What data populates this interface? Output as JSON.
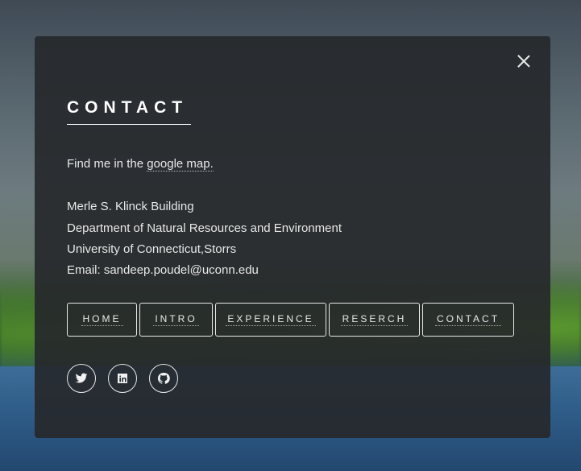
{
  "modal": {
    "title": "CONTACT",
    "map_prefix": "Find me in the ",
    "map_link": "google map.",
    "address": [
      "Merle S. Klinck Building",
      "Department of Natural Resources and Environment",
      "University of Connecticut,Storrs",
      "Email: sandeep.poudel@uconn.edu"
    ]
  },
  "nav": [
    "HOME",
    "INTRO",
    "EXPERIENCE",
    "RESERCH",
    "CONTACT"
  ],
  "socials": [
    "twitter-icon",
    "linkedin-icon",
    "github-icon"
  ]
}
